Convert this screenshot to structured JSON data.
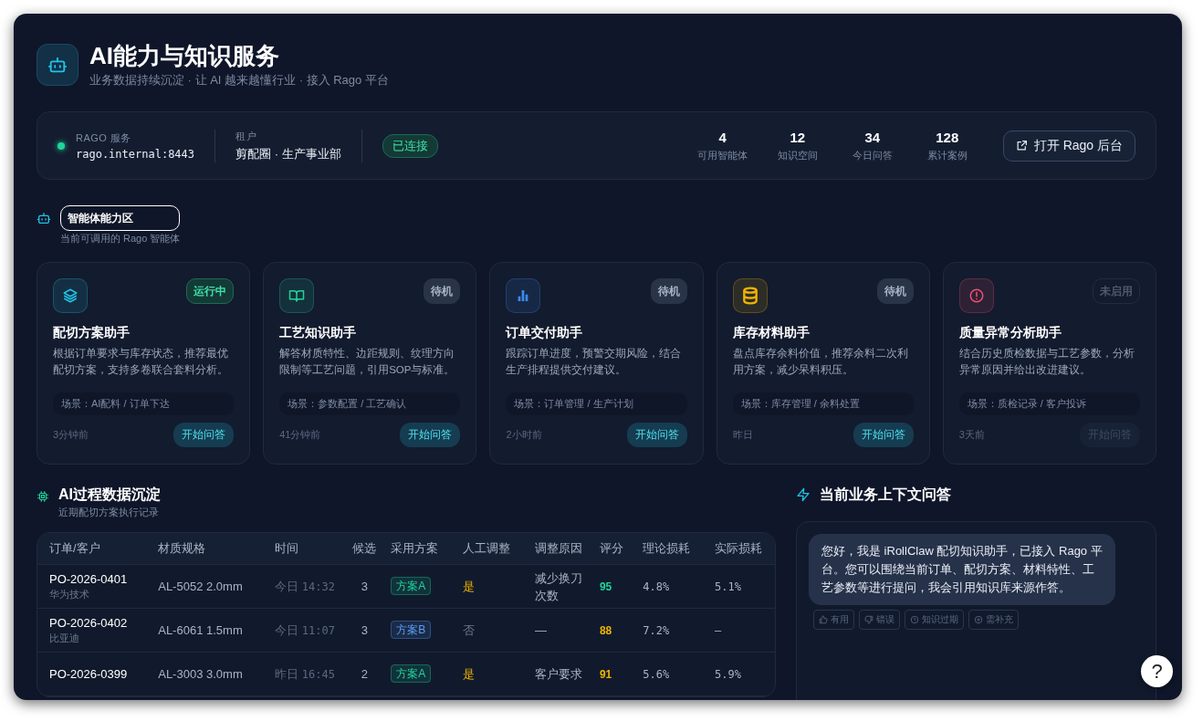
{
  "header": {
    "title": "AI能力与知识服务",
    "subtitle": "业务数据持续沉淀 · 让 AI 越来越懂行业 · 接入 Rago 平台"
  },
  "service": {
    "label": "RAGO 服务",
    "address": "rago.internal:8443",
    "online": true,
    "tenant_label": "租户",
    "tenant": "剪配圈 · 生产事业部",
    "connection": "已连接"
  },
  "stats": [
    {
      "value": "4",
      "label": "可用智能体"
    },
    {
      "value": "12",
      "label": "知识空间"
    },
    {
      "value": "34",
      "label": "今日问答"
    },
    {
      "value": "128",
      "label": "累计案例"
    }
  ],
  "open_button": "打开 Rago 后台",
  "agents_section": {
    "title": "智能体能力区",
    "subtitle": "当前可调用的 Rago 智能体"
  },
  "agents": [
    {
      "name": "配切方案助手",
      "description": "根据订单要求与库存状态，推荐最优配切方案，支持多卷联合套料分析。",
      "scene": "场景：AI配料 / 订单下达",
      "time": "3分钟前",
      "status": "运行中",
      "kind": "running",
      "color": "#22c3e6",
      "button": "开始问答",
      "disabled": false
    },
    {
      "name": "工艺知识助手",
      "description": "解答材质特性、边距规则、纹理方向限制等工艺问题，引用SOP与标准。",
      "scene": "场景：参数配置 / 工艺确认",
      "time": "41分钟前",
      "status": "待机",
      "kind": "idle",
      "color": "#1fd49a",
      "button": "开始问答",
      "disabled": false
    },
    {
      "name": "订单交付助手",
      "description": "跟踪订单进度，预警交期风险，结合生产排程提供交付建议。",
      "scene": "场景：订单管理 / 生产计划",
      "time": "2小时前",
      "status": "待机",
      "kind": "idle",
      "color": "#3b8cf0",
      "button": "开始问答",
      "disabled": false
    },
    {
      "name": "库存材料助手",
      "description": "盘点库存余料价值，推荐余料二次利用方案，减少呆料积压。",
      "scene": "场景：库存管理 / 余料处置",
      "time": "昨日",
      "status": "待机",
      "kind": "idle",
      "color": "#f0b400",
      "button": "开始问答",
      "disabled": false
    },
    {
      "name": "质量异常分析助手",
      "description": "结合历史质检数据与工艺参数，分析异常原因并给出改进建议。",
      "scene": "场景：质检记录 / 客户投诉",
      "time": "3天前",
      "status": "未启用",
      "kind": "disabled",
      "color": "#f0506e",
      "button": "开始问答",
      "disabled": true
    }
  ],
  "records_section": {
    "title": "AI过程数据沉淀",
    "subtitle": "近期配切方案执行记录"
  },
  "table": {
    "columns": [
      "订单/客户",
      "材质规格",
      "时间",
      "候选",
      "采用方案",
      "人工调整",
      "调整原因",
      "评分",
      "理论损耗",
      "实际损耗"
    ],
    "rows": [
      {
        "order": "PO-2026-0401",
        "customer": "华为技术",
        "spec": "AL-5052 2.0mm",
        "day": "今日",
        "time": "14:32",
        "candidates": "3",
        "plan": {
          "text": "方案A",
          "color": "#1fd49a"
        },
        "adjusted": true,
        "adjusted_label": "是",
        "reason": "减少换刀次数",
        "score": {
          "text": "95",
          "color": "#1fd49a"
        },
        "theory_loss": "4.8%",
        "actual_loss": "5.1%"
      },
      {
        "order": "PO-2026-0402",
        "customer": "比亚迪",
        "spec": "AL-6061 1.5mm",
        "day": "今日",
        "time": "11:07",
        "candidates": "3",
        "plan": {
          "text": "方案B",
          "color": "#5b9cf5"
        },
        "adjusted": false,
        "adjusted_label": "否",
        "reason": "—",
        "score": {
          "text": "88",
          "color": "#f0b400"
        },
        "theory_loss": "7.2%",
        "actual_loss": "–"
      },
      {
        "order": "PO-2026-0399",
        "spec": "AL-3003 3.0mm",
        "day": "昨日",
        "time": "16:45",
        "candidates": "2",
        "plan": {
          "text": "方案A",
          "color": "#1fd49a"
        },
        "adjusted": true,
        "adjusted_label": "是",
        "reason": "客户要求",
        "score": {
          "text": "91",
          "color": "#f0b400"
        },
        "theory_loss": "5.6%",
        "actual_loss": "5.9%"
      }
    ]
  },
  "chat": {
    "title": "当前业务上下文问答",
    "message": "您好，我是 iRollClaw 配切知识助手，已接入 Rago 平台。您可以围绕当前订单、配切方案、材料特性、工艺参数等进行提问，我会引用知识库来源作答。",
    "feedback": [
      "有用",
      "错误",
      "知识过期",
      "需补充"
    ]
  },
  "help_button": "?"
}
